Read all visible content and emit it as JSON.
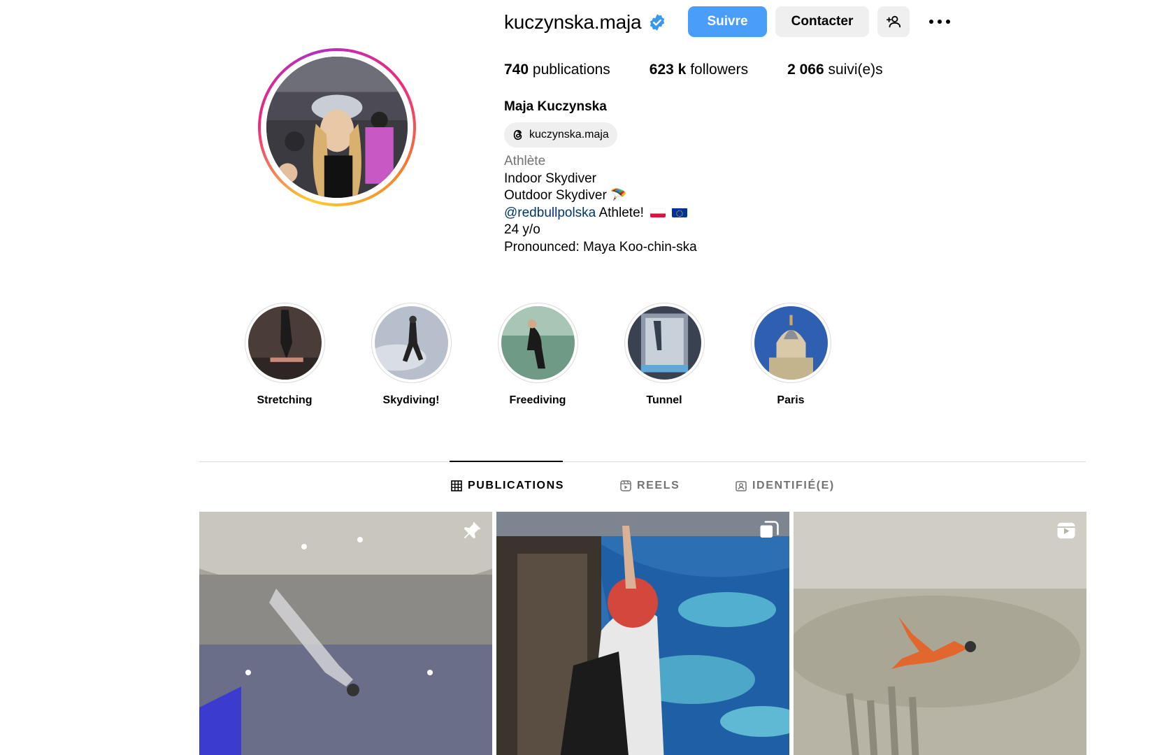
{
  "profile": {
    "username": "kuczynska.maja",
    "verified": true,
    "follow_label": "Suivre",
    "contact_label": "Contacter",
    "stats": {
      "posts_count": "740",
      "posts_label": "publications",
      "followers_count": "623 k",
      "followers_label": "followers",
      "following_count": "2 066",
      "following_label": "suivi(e)s"
    },
    "full_name": "Maja Kuczynska",
    "threads_handle": "kuczynska.maja",
    "bio": {
      "category": "Athlète",
      "line1": "Indoor Skydiver",
      "line2": "Outdoor Skydiver 🪂",
      "mention": "@redbullpolska",
      "line3_rest": "Athlete!",
      "line4": "24 y/o",
      "line5": "Pronounced: Maya Koo-chin-ska"
    }
  },
  "highlights": [
    {
      "label": "Stretching"
    },
    {
      "label": "Skydiving!"
    },
    {
      "label": "Freediving"
    },
    {
      "label": "Tunnel"
    },
    {
      "label": "Paris"
    }
  ],
  "tabs": [
    {
      "label": "PUBLICATIONS",
      "active": true,
      "icon": "grid-icon"
    },
    {
      "label": "REELS",
      "active": false,
      "icon": "reels-icon"
    },
    {
      "label": "IDENTIFIÉ(E)",
      "active": false,
      "icon": "tagged-icon"
    }
  ],
  "posts": [
    {
      "badge": "pin-icon"
    },
    {
      "badge": "carousel-icon"
    },
    {
      "badge": "reel-icon"
    }
  ],
  "colors": {
    "accent": "#4a9df8",
    "verified": "#3897f0",
    "mention": "#00376b",
    "muted": "#737373"
  }
}
